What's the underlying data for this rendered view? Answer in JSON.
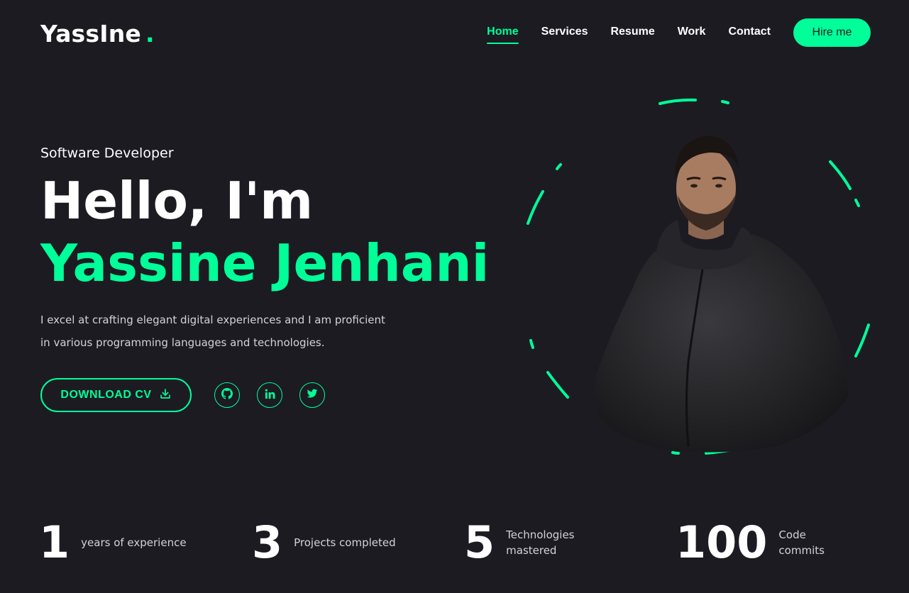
{
  "header": {
    "logo": "YassIne",
    "logo_dot": ".",
    "nav": [
      "Home",
      "Services",
      "Resume",
      "Work",
      "Contact"
    ],
    "active_nav": "Home",
    "hire_label": "Hire me"
  },
  "hero": {
    "role": "Software Developer",
    "greeting": "Hello, I'm",
    "name": "Yassine Jenhani",
    "description": "I excel at crafting elegant digital experiences and I am proficient in various programming languages and technologies.",
    "cv_label": "DOWNLOAD CV",
    "socials": [
      "github-icon",
      "linkedin-icon",
      "twitter-icon"
    ]
  },
  "stats": [
    {
      "num": "1",
      "label": "years of experience"
    },
    {
      "num": "3",
      "label": "Projects completed"
    },
    {
      "num": "5",
      "label": "Technologies mastered"
    },
    {
      "num": "100",
      "label": "Code commits"
    }
  ],
  "colors": {
    "accent": "#00ff99",
    "background": "#1c1b22",
    "text": "#ffffff"
  }
}
